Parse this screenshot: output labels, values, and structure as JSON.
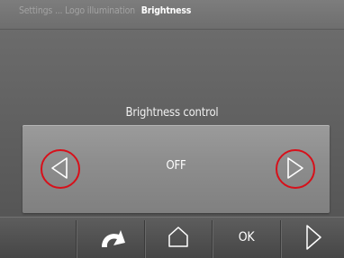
{
  "breadcrumb": {
    "path": "Settings ... Logo illumination",
    "current": "Brightness"
  },
  "control": {
    "title": "Brightness control",
    "value": "OFF",
    "highlight_color": "#d7101a"
  },
  "nav_buttons": {
    "decrease_icon": "chevron-left-icon",
    "increase_icon": "chevron-right-icon"
  },
  "bottom_bar": {
    "back_icon": "back-arrow-icon",
    "home_icon": "home-icon",
    "ok_label": "OK",
    "next_icon": "chevron-right-icon"
  }
}
